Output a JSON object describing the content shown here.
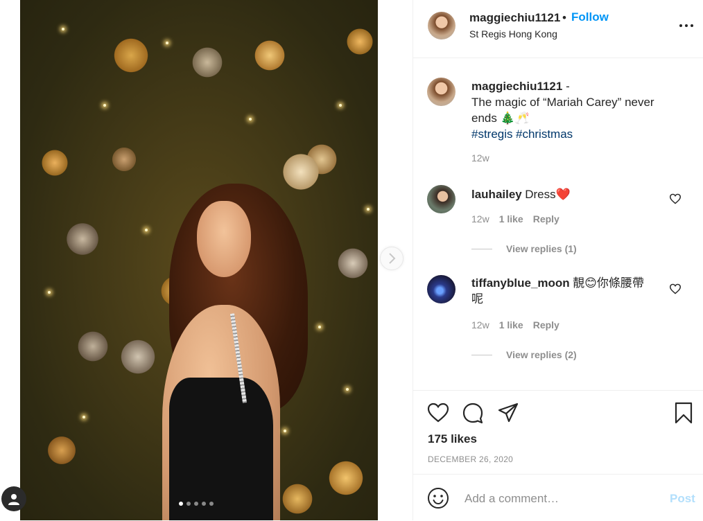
{
  "post": {
    "author": "maggiechiu1121",
    "follow_label": "Follow",
    "separator": "•",
    "location": "St Regis Hong Kong",
    "likes": "175 likes",
    "date": "DECEMBER 26, 2020",
    "carousel": {
      "count": 5,
      "active": 1
    }
  },
  "caption": {
    "author": "maggiechiu1121",
    "dash": " -",
    "line1": "The magic of “Mariah Carey” never",
    "line2": "ends 🎄🥂",
    "hashtag1": "#stregis",
    "hashtag2": "#christmas",
    "time": "12w"
  },
  "comments": [
    {
      "user": "lauhailey",
      "text": "Dress",
      "emoji": "❤️",
      "time": "12w",
      "likes": "1 like",
      "reply": "Reply",
      "view_replies": "View replies (1)"
    },
    {
      "user": "tiffanyblue_moon",
      "text": "靚😊你條腰帶",
      "text2": "呢",
      "time": "12w",
      "likes": "1 like",
      "reply": "Reply",
      "view_replies": "View replies (2)"
    }
  ],
  "add_comment": {
    "placeholder": "Add a comment…",
    "post_label": "Post"
  },
  "icons": {
    "more": "more-options-icon",
    "like": "heart-icon",
    "comment": "comment-icon",
    "share": "share-icon",
    "save": "bookmark-icon",
    "emoji": "emoji-icon",
    "next": "chevron-right-icon",
    "user": "user-icon"
  },
  "colors": {
    "accent": "#0095f6",
    "hashtag": "#00376b",
    "muted": "#8e8e8e",
    "post_disabled": "#b2dffc"
  }
}
